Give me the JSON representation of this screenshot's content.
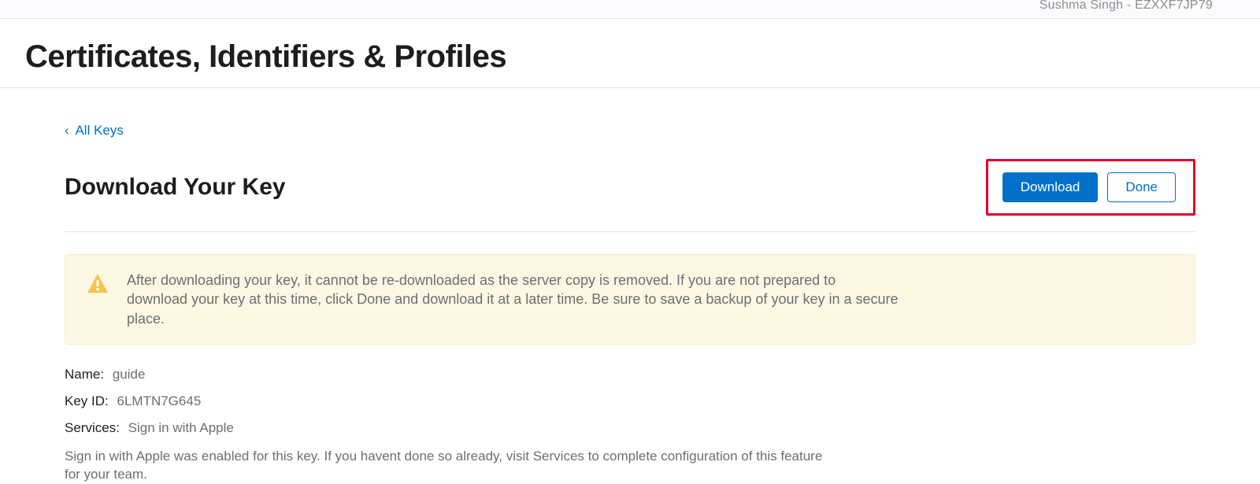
{
  "account": {
    "display": "Sushma Singh - EZXXF7JP79"
  },
  "header": {
    "title": "Certificates, Identifiers & Profiles"
  },
  "nav": {
    "back_label": "All Keys"
  },
  "section": {
    "title": "Download Your Key"
  },
  "buttons": {
    "download": "Download",
    "done": "Done"
  },
  "warning": {
    "text": "After downloading your key, it cannot be re-downloaded as the server copy is removed. If you are not prepared to download your key at this time, click Done and download it at a later time. Be sure to save a backup of your key in a secure place."
  },
  "details": {
    "name": {
      "label": "Name",
      "value": "guide"
    },
    "key_id": {
      "label": "Key ID",
      "value": "6LMTN7G645"
    },
    "services": {
      "label": "Services",
      "value": "Sign in with Apple"
    },
    "note": "Sign in with Apple was enabled for this key. If you havent done so already, visit Services to complete configuration of this feature for your team."
  },
  "colors": {
    "apple_blue": "#0070c9",
    "highlight_red": "#e3002b",
    "warn_bg": "#fdf8e3"
  }
}
